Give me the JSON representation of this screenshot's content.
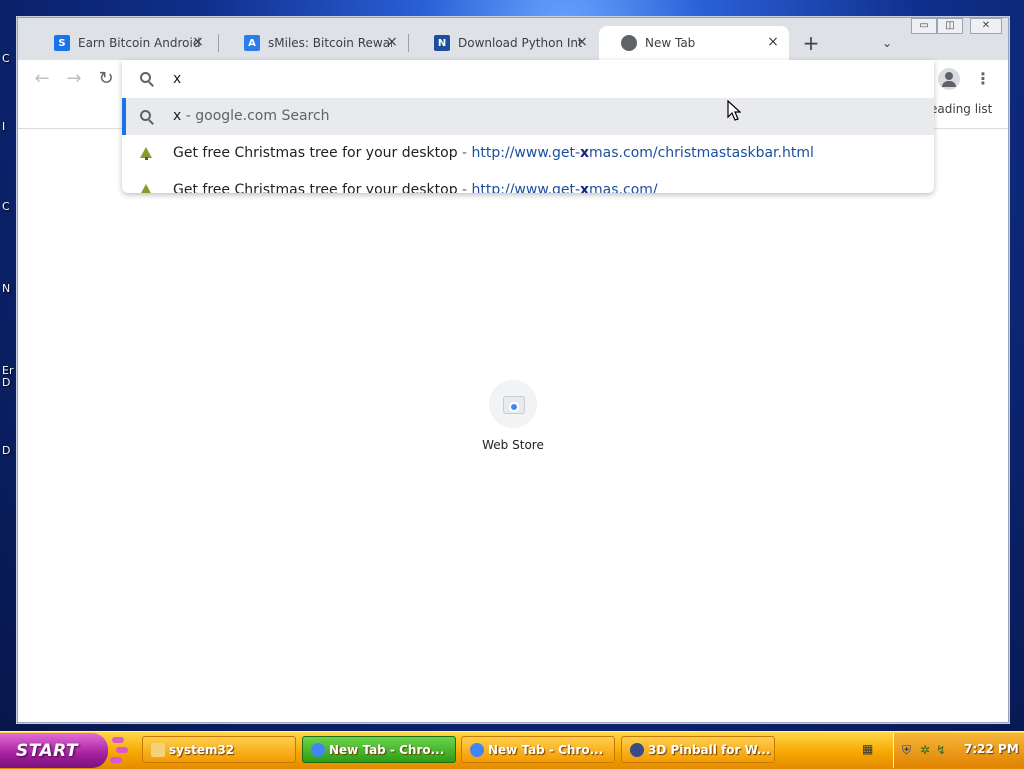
{
  "desktop": {
    "fragments": [
      "C",
      "I",
      "C",
      "N",
      "Er",
      "D",
      "D"
    ]
  },
  "browser": {
    "tabs": [
      {
        "title": "Earn Bitcoin Android App",
        "favicon": "S",
        "favicon_color": "#1a73e8",
        "active": false
      },
      {
        "title": "sMiles: Bitcoin Rewards",
        "favicon": "A",
        "favicon_color": "#2b7de9",
        "active": false
      },
      {
        "title": "Download Python Interpreter",
        "favicon": "N",
        "favicon_color": "#1f4e9c",
        "active": false
      },
      {
        "title": "New Tab",
        "favicon": "globe",
        "favicon_color": "#5f6368",
        "active": true
      }
    ],
    "new_tab_symbol": "+",
    "tab_search_symbol": "⌄",
    "window_controls": {
      "minimize": "▭",
      "restore": "◫",
      "close": "✕"
    },
    "nav": {
      "back": "←",
      "forward": "→",
      "reload": "↻"
    },
    "omnibox": {
      "value": "x",
      "suggestions": [
        {
          "prefix": "x",
          "separator": " - ",
          "desc": "google.com Search",
          "type": "search"
        },
        {
          "desc_text": "Get free Christmas tree for your desktop",
          "separator": " - ",
          "url_pre": "http://www.get-",
          "url_match": "x",
          "url_post": "mas.com/christmastaskbar.html",
          "type": "history"
        },
        {
          "desc_text": "Get free Christmas tree for your desktop",
          "separator": " - ",
          "url_pre": "http://www.get-",
          "url_match": "x",
          "url_post": "mas.com/",
          "type": "history"
        }
      ]
    },
    "reading_list_label": "eading list",
    "menu_symbol": "⋮",
    "shortcut": {
      "label": "Web Store"
    }
  },
  "taskbar": {
    "start_label": "START",
    "buttons": [
      {
        "label": "system32",
        "icon_color": "#f4d27a",
        "active": false
      },
      {
        "label": "New Tab - Chro...",
        "icon_color": "#4285f4",
        "active": true
      },
      {
        "label": "New Tab - Chro...",
        "icon_color": "#4285f4",
        "active": false
      },
      {
        "label": "3D Pinball for W...",
        "icon_color": "#3b4a8a",
        "active": false
      }
    ],
    "clock": "7:22 PM"
  }
}
